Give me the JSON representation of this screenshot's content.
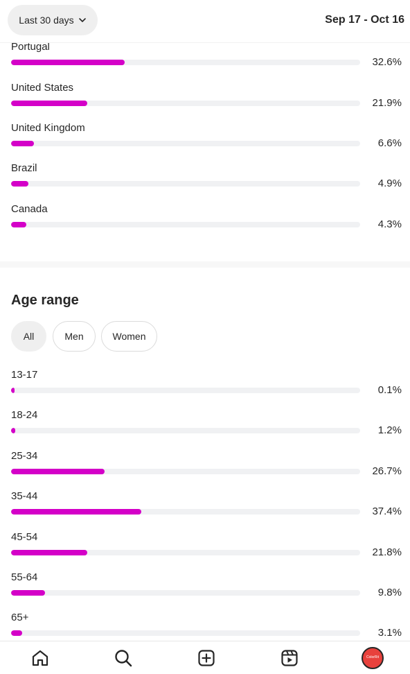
{
  "header": {
    "range_label": "Last 30 days",
    "date_range": "Sep 17 - Oct 16"
  },
  "countries": [
    {
      "label": "Portugal",
      "value": "32.6%",
      "percent": 32.6
    },
    {
      "label": "United States",
      "value": "21.9%",
      "percent": 21.9
    },
    {
      "label": "United Kingdom",
      "value": "6.6%",
      "percent": 6.6
    },
    {
      "label": "Brazil",
      "value": "4.9%",
      "percent": 4.9
    },
    {
      "label": "Canada",
      "value": "4.3%",
      "percent": 4.3
    }
  ],
  "age_section": {
    "title": "Age range",
    "filters": [
      {
        "label": "All",
        "active": true
      },
      {
        "label": "Men",
        "active": false
      },
      {
        "label": "Women",
        "active": false
      }
    ],
    "rows": [
      {
        "label": "13-17",
        "value": "0.1%",
        "percent": 0.1
      },
      {
        "label": "18-24",
        "value": "1.2%",
        "percent": 1.2
      },
      {
        "label": "25-34",
        "value": "26.7%",
        "percent": 26.7
      },
      {
        "label": "35-44",
        "value": "37.4%",
        "percent": 37.4
      },
      {
        "label": "45-54",
        "value": "21.8%",
        "percent": 21.8
      },
      {
        "label": "55-64",
        "value": "9.8%",
        "percent": 9.8
      },
      {
        "label": "65+",
        "value": "3.1%",
        "percent": 3.1
      }
    ]
  },
  "bottom_nav": {
    "items": [
      "home-icon",
      "search-icon",
      "create-icon",
      "reels-icon",
      "profile-avatar"
    ],
    "avatar_text": "ColorRit"
  },
  "colors": {
    "bar_fill": "#d400c8",
    "bar_track": "#f0f1f3",
    "avatar_bg": "#e8413c"
  }
}
